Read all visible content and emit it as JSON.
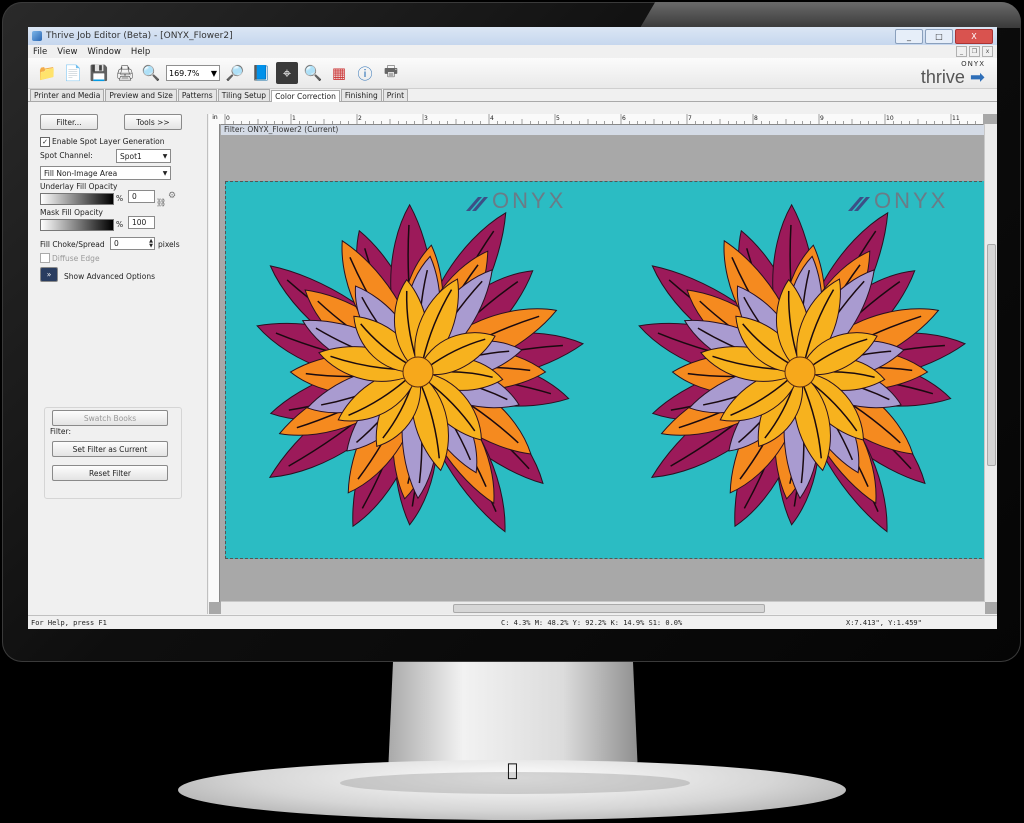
{
  "window": {
    "title": "Thrive Job Editor (Beta) - [ONYX_Flower2]",
    "minimize": "_",
    "maximize": "□",
    "close": "X"
  },
  "menu": [
    "File",
    "View",
    "Window",
    "Help"
  ],
  "toolbar": {
    "zoom_value": "169.7%",
    "brand_top": "ONYX",
    "brand_name": "thrive"
  },
  "tabs": [
    {
      "label": "Printer and Media"
    },
    {
      "label": "Preview and Size"
    },
    {
      "label": "Patterns"
    },
    {
      "label": "Tiling Setup"
    },
    {
      "label": "Color Correction",
      "active": true
    },
    {
      "label": "Finishing"
    },
    {
      "label": "Print"
    }
  ],
  "panel": {
    "filter_button": "Filter...",
    "tools_button": "Tools >>",
    "enable_spot_label": "Enable Spot Layer Generation",
    "enable_spot_checked": "✓",
    "spot_channel_label": "Spot Channel:",
    "spot_channel_value": "Spot1",
    "fill_mode_value": "Fill Non-Image Area",
    "underlay_label": "Underlay Fill Opacity",
    "underlay_value": "0",
    "mask_label": "Mask Fill Opacity",
    "mask_value": "100",
    "percent": "%",
    "choke_label": "Fill Choke/Spread",
    "choke_value": "0",
    "choke_unit": "pixels",
    "diffuse_label": "Diffuse Edge",
    "advanced_label": "Show Advanced Options",
    "swatch_books": "Swatch Books",
    "filter_group_label": "Filter:",
    "set_filter_button": "Set Filter as Current",
    "reset_filter_button": "Reset Filter"
  },
  "workarea": {
    "ruler_unit": "in",
    "ruler_numbers": [
      "0",
      "1",
      "2",
      "3",
      "4",
      "5",
      "6",
      "7",
      "8",
      "9",
      "10",
      "11"
    ],
    "filter_caption": "Filter: ONYX_Flower2 (Current)",
    "logo_text": "ONYX"
  },
  "status": {
    "help": "For Help, press F1",
    "color": "C:  4.3% M: 48.2% Y: 92.2% K: 14.9% S1:  0.0%",
    "coords": "X:7.413\", Y:1.459\""
  },
  "colors": {
    "canvas_bg": "#2bbcc3",
    "petal_magenta": "#9c1a5a",
    "petal_orange": "#f58a1f",
    "petal_yellow": "#f7b21e",
    "petal_lavender": "#a99bd0",
    "center": "#f7a81b"
  }
}
